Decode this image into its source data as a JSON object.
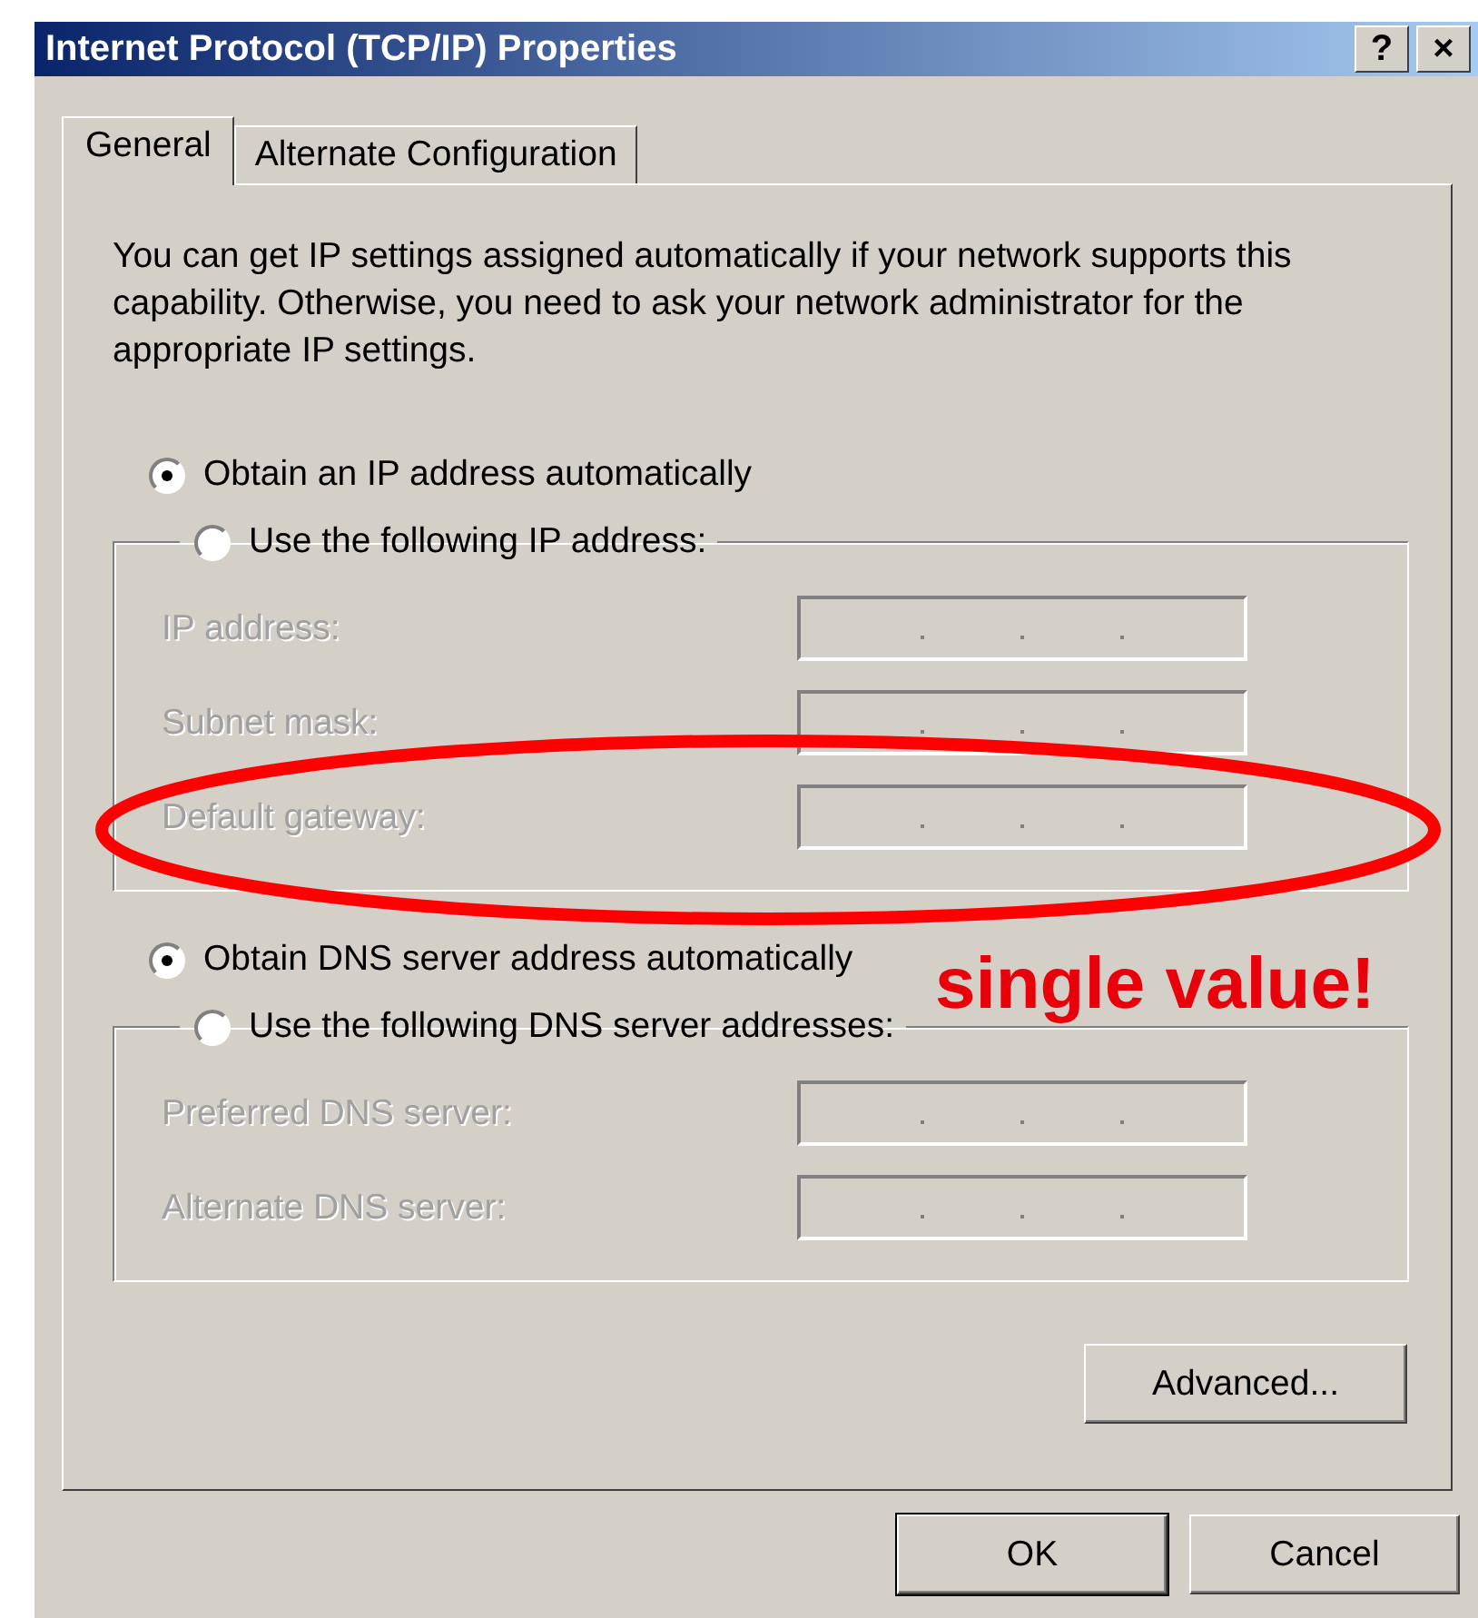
{
  "window": {
    "title": "Internet Protocol (TCP/IP) Properties",
    "title_buttons": [
      "?",
      "×"
    ]
  },
  "tabs": [
    {
      "label": "General",
      "selected": true
    },
    {
      "label": "Alternate Configuration",
      "selected": false
    }
  ],
  "description": "You can get IP settings assigned automatically if your network supports this capability. Otherwise, you need to ask your network administrator for the appropriate IP settings.",
  "sections": [
    {
      "auto_option": {
        "label": "Obtain an IP address automatically",
        "selected": true
      },
      "manual_option": {
        "label": "Use the following IP address:",
        "selected": false
      },
      "fields": [
        {
          "label": "IP address:",
          "disabled": true
        },
        {
          "label": "Subnet mask:",
          "disabled": true
        },
        {
          "label": "Default gateway:",
          "disabled": true
        }
      ]
    },
    {
      "auto_option": {
        "label": "Obtain DNS server address automatically",
        "selected": true
      },
      "manual_option": {
        "label": "Use the following DNS server addresses:",
        "selected": false
      },
      "fields": [
        {
          "label": "Preferred DNS server:",
          "disabled": true
        },
        {
          "label": "Alternate DNS server:",
          "disabled": true
        }
      ]
    }
  ],
  "advanced_button": "Advanced...",
  "buttons": [
    "OK",
    "Cancel"
  ],
  "annotation": {
    "text": "single value!"
  }
}
